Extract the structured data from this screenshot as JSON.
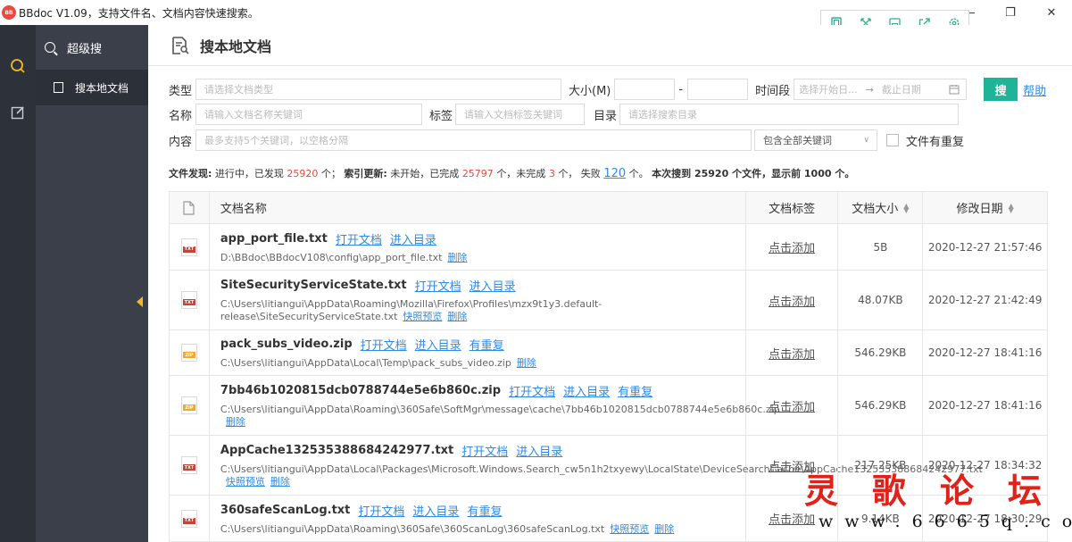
{
  "window": {
    "title": "BBdoc V1.09，支持文件名、文档内容快速搜索。",
    "toolbar_icons": [
      "tablet-icon",
      "fullscreen-icon",
      "save-icon",
      "share-icon",
      "settings-icon"
    ],
    "controls": {
      "minimize": "—",
      "restore": "❐",
      "close": "✕"
    }
  },
  "sidebar": {
    "section_label": "超级搜",
    "items": [
      {
        "label": "搜本地文档"
      }
    ]
  },
  "page": {
    "title": "搜本地文档"
  },
  "form": {
    "type_label": "类型",
    "type_placeholder": "请选择文档类型",
    "size_label": "大小(M)",
    "size_separator": "-",
    "time_label": "时间段",
    "time_start_placeholder": "选择开始日...",
    "time_arrow": "→",
    "time_end_placeholder": "截止日期",
    "search_button": "搜",
    "help_link": "帮助",
    "name_label": "名称",
    "name_placeholder": "请输入文档名称关键词",
    "tag_label": "标签",
    "tag_placeholder": "请输入文档标签关键词",
    "dir_label": "目录",
    "dir_placeholder": "请选择搜索目录",
    "content_label": "内容",
    "content_placeholder": "最多支持5个关键词，以空格分隔",
    "match_select": "包含全部关键词",
    "duplicate_checkbox_label": "文件有重复"
  },
  "status": {
    "discovery_label": "文件发现:",
    "discovery_text_1": "进行中，已发现",
    "discovered": "25920",
    "discovery_text_2": "个；",
    "index_label": "索引更新:",
    "index_text_1": "未开始，已完成",
    "completed": "25797",
    "index_text_2": "个，未完成",
    "uncompleted": "3",
    "index_text_3": "个，  失败",
    "failed": "120",
    "index_text_4": "个。",
    "summary": "本次搜到 25920 个文件，显示前 1000 个。"
  },
  "table": {
    "headers": {
      "name": "文档名称",
      "tag": "文档标签",
      "size": "文档大小",
      "date": "修改日期"
    },
    "rows": [
      {
        "type": "TXT",
        "name": "app_port_file.txt",
        "actions": [
          "打开文档",
          "进入目录"
        ],
        "path": "D:\\BBdoc\\BBdocV108\\config\\app_port_file.txt",
        "path_links": [
          "删除"
        ],
        "tag": "点击添加",
        "size": "5B",
        "date": "2020-12-27 21:57:46"
      },
      {
        "type": "TXT",
        "name": "SiteSecurityServiceState.txt",
        "actions": [
          "打开文档",
          "进入目录"
        ],
        "path": "C:\\Users\\litiangui\\AppData\\Roaming\\Mozilla\\Firefox\\Profiles\\mzx9t1y3.default-release\\SiteSecurityServiceState.txt",
        "path_links": [
          "快照预览",
          "删除"
        ],
        "tag": "点击添加",
        "size": "48.07KB",
        "date": "2020-12-27 21:42:49"
      },
      {
        "type": "ZIP",
        "name": "pack_subs_video.zip",
        "actions": [
          "打开文档",
          "进入目录",
          "有重复"
        ],
        "path": "C:\\Users\\litiangui\\AppData\\Local\\Temp\\pack_subs_video.zip",
        "path_links": [
          "删除"
        ],
        "tag": "点击添加",
        "size": "546.29KB",
        "date": "2020-12-27 18:41:16"
      },
      {
        "type": "ZIP",
        "name": "7bb46b1020815dcb0788744e5e6b860c.zip",
        "actions": [
          "打开文档",
          "进入目录",
          "有重复"
        ],
        "path": "C:\\Users\\litiangui\\AppData\\Roaming\\360Safe\\SoftMgr\\message\\cache\\7bb46b1020815dcb0788744e5e6b860c.zip",
        "path_links": [
          "删除"
        ],
        "tag": "点击添加",
        "size": "546.29KB",
        "date": "2020-12-27 18:41:16"
      },
      {
        "type": "TXT",
        "name": "AppCache132535388684242977.txt",
        "actions": [
          "打开文档",
          "进入目录"
        ],
        "path": "C:\\Users\\litiangui\\AppData\\Local\\Packages\\Microsoft.Windows.Search_cw5n1h2txyewy\\LocalState\\DeviceSearchCache\\AppCache132535388684242977.txt",
        "path_links": [
          "快照预览",
          "删除"
        ],
        "tag": "点击添加",
        "size": "217.25KB",
        "date": "2020-12-27 18:34:32"
      },
      {
        "type": "TXT",
        "name": "360safeScanLog.txt",
        "actions": [
          "打开文档",
          "进入目录",
          "有重复"
        ],
        "path": "C:\\Users\\litiangui\\AppData\\Roaming\\360Safe\\360ScanLog\\360safeScanLog.txt",
        "path_links": [
          "快照预览",
          "删除"
        ],
        "tag": "点击添加",
        "size": "9.14KB",
        "date": "2020-12-27 18:30:29"
      }
    ]
  },
  "watermark": {
    "title": "灵歌论坛",
    "url": "www.6665q.com"
  }
}
